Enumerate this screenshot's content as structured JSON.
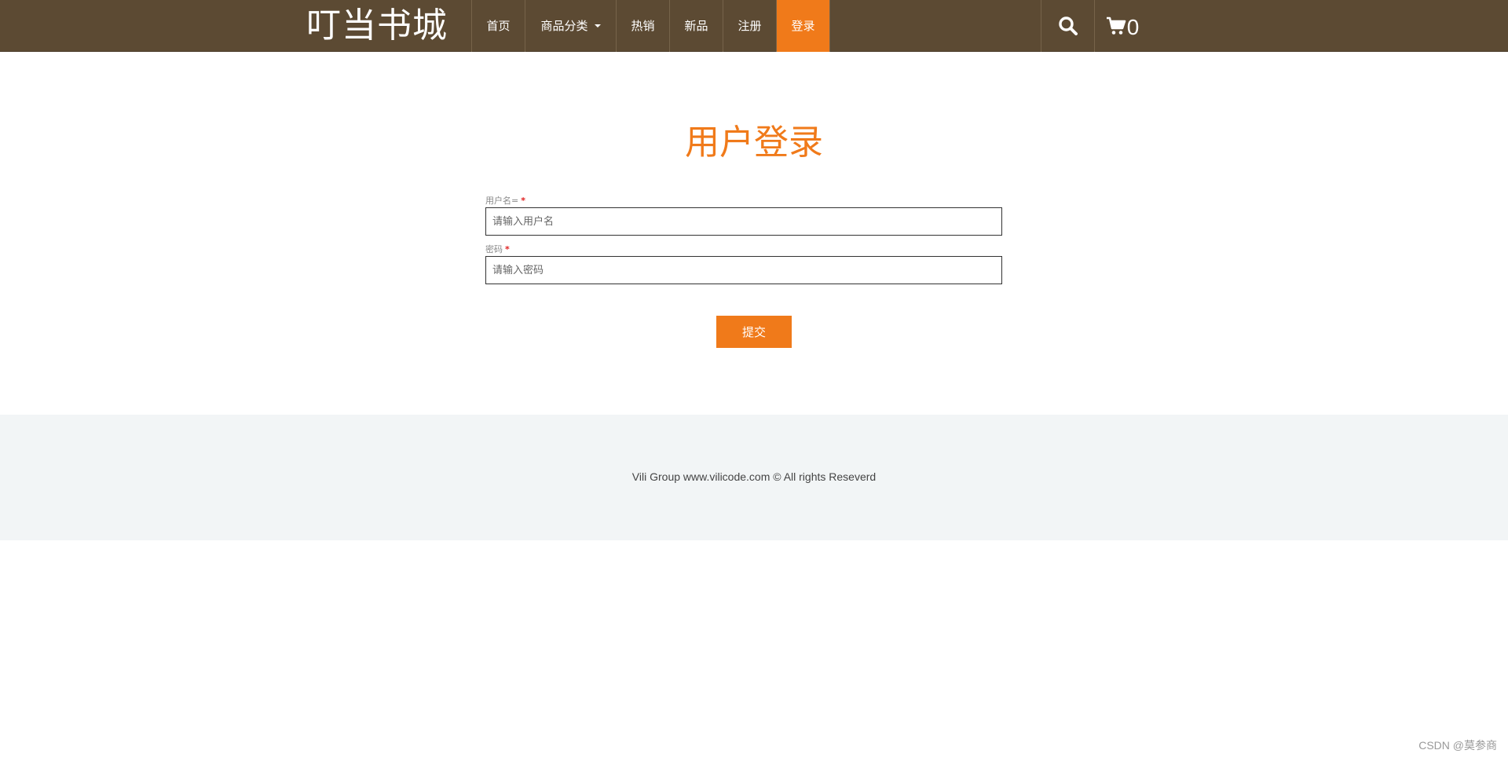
{
  "header": {
    "brand": "叮当书城",
    "nav": [
      {
        "label": "首页"
      },
      {
        "label": "商品分类"
      },
      {
        "label": "热销"
      },
      {
        "label": "新品"
      },
      {
        "label": "注册"
      },
      {
        "label": "登录"
      }
    ],
    "active_nav": "登录",
    "search_icon": "search-icon",
    "cart_icon": "cart-icon",
    "cart_count": "0"
  },
  "main": {
    "title": "用户登录",
    "username": {
      "label": "用户名=",
      "required_mark": "*",
      "placeholder": "请输入用户名",
      "value": ""
    },
    "password": {
      "label": "密码",
      "required_mark": "*",
      "placeholder": "请输入密码",
      "value": ""
    },
    "submit_label": "提交"
  },
  "footer": {
    "copyright": "Vili Group www.vilicode.com © All rights Reseverd"
  },
  "watermark": "CSDN @莫参商",
  "colors": {
    "header_bg": "#5c4a33",
    "accent": "#f07a1a",
    "footer_bg": "#f2f5f6"
  }
}
